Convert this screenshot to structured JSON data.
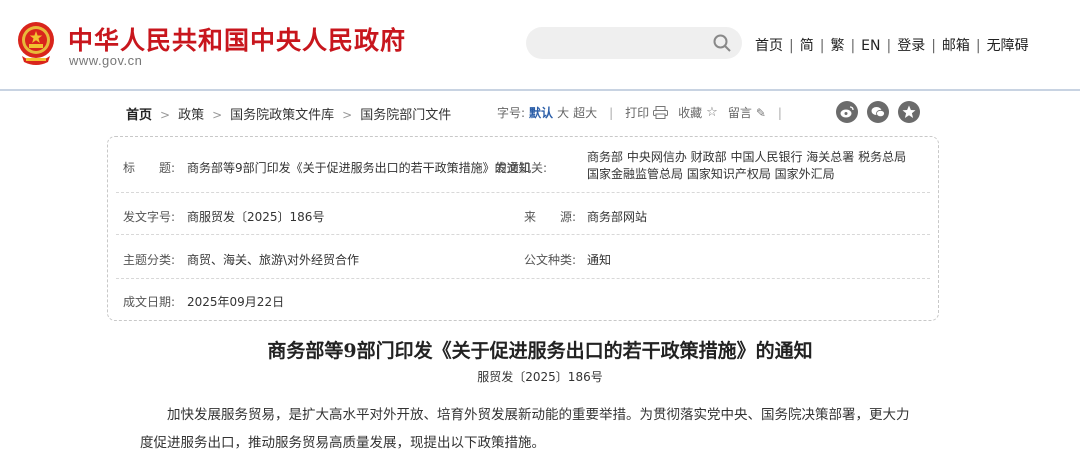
{
  "header": {
    "site_title": "中华人民共和国中央人民政府",
    "site_url": "www.gov.cn",
    "search_placeholder": "",
    "nav": [
      "首页",
      "简",
      "繁",
      "EN",
      "登录",
      "邮箱",
      "无障碍"
    ],
    "brand_color": "#c8161d"
  },
  "breadcrumb": [
    "首页",
    "政策",
    "国务院政策文件库",
    "国务院部门文件"
  ],
  "tools": {
    "font_size_label": "字号:",
    "font_default": "默认",
    "font_large": "大",
    "font_xlarge": "超大",
    "print": "打印",
    "favorite": "收藏",
    "comment": "留言",
    "share_icons": [
      "weibo-icon",
      "wechat-icon",
      "qzone-icon"
    ]
  },
  "info": {
    "title_label": "标　　题:",
    "title_value": "商务部等9部门印发《关于促进服务出口的若干政策措施》的通知",
    "issuer_label": "发文机关:",
    "issuer_value": "商务部 中央网信办 财政部 中国人民银行 海关总署 税务总局 国家金融监管总局 国家知识产权局 国家外汇局",
    "doc_no_label": "发文字号:",
    "doc_no_value": "商服贸发〔2025〕186号",
    "source_label": "来　　源:",
    "source_value": "商务部网站",
    "topic_label": "主题分类:",
    "topic_value": "商贸、海关、旅游\\对外经贸合作",
    "doc_type_label": "公文种类:",
    "doc_type_value": "通知",
    "date_label": "成文日期:",
    "date_value": "2025年09月22日"
  },
  "article": {
    "title": "商务部等9部门印发《关于促进服务出口的若干政策措施》的通知",
    "doc_number": "服贸发〔2025〕186号",
    "paragraph": "加快发展服务贸易，是扩大高水平对外开放、培育外贸发展新动能的重要举措。为贯彻落实党中央、国务院决策部署，更大力度促进服务出口，推动服务贸易高质量发展，现提出以下政策措施。"
  }
}
